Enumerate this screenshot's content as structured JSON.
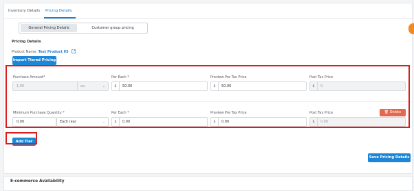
{
  "tabs": [
    {
      "label": "Inventory Details"
    },
    {
      "label": "Pricing Details"
    }
  ],
  "segments": [
    {
      "label": "General Pricing Details"
    },
    {
      "label": "Customer group pricing"
    }
  ],
  "section_title": "Pricing Details",
  "product": {
    "label": "Product Name:",
    "name": "Test Product 65"
  },
  "import_button": "Import Tiered Pricing",
  "row1": {
    "labels": {
      "amount": "Purchase Amount*",
      "per_each": "Per Each *",
      "preview": "Preview Pre Tax Price",
      "post": "Post Tax Price"
    },
    "amount_value": "1.00",
    "unit_value": "ea",
    "per_each_prefix": "$",
    "per_each_value": "50.00",
    "preview_prefix": "$",
    "preview_value": "50.00",
    "post_prefix": "$",
    "post_value": "0"
  },
  "row2": {
    "labels": {
      "qty": "Minimum Purchase Quantity *",
      "per_each": "Per Each *",
      "preview": "Preview Pre Tax Price",
      "post": "Post Tax Price"
    },
    "qty_value": "0.00",
    "unit_value": "Each (ea)",
    "per_each_prefix": "$",
    "per_each_value": "0.00",
    "preview_prefix": "$",
    "preview_value": "0.00",
    "post_prefix": "$",
    "post_value": "0.00",
    "delete_label": "Delete"
  },
  "add_tier_button": "Add Tier",
  "save_button": "Save Pricing Details",
  "ecommerce_title": "E-commerce Availability",
  "colors": {
    "primary": "#1d86d6",
    "delete": "#e2684f",
    "highlight": "#d81e1e",
    "side_tab": "#f08a24"
  }
}
